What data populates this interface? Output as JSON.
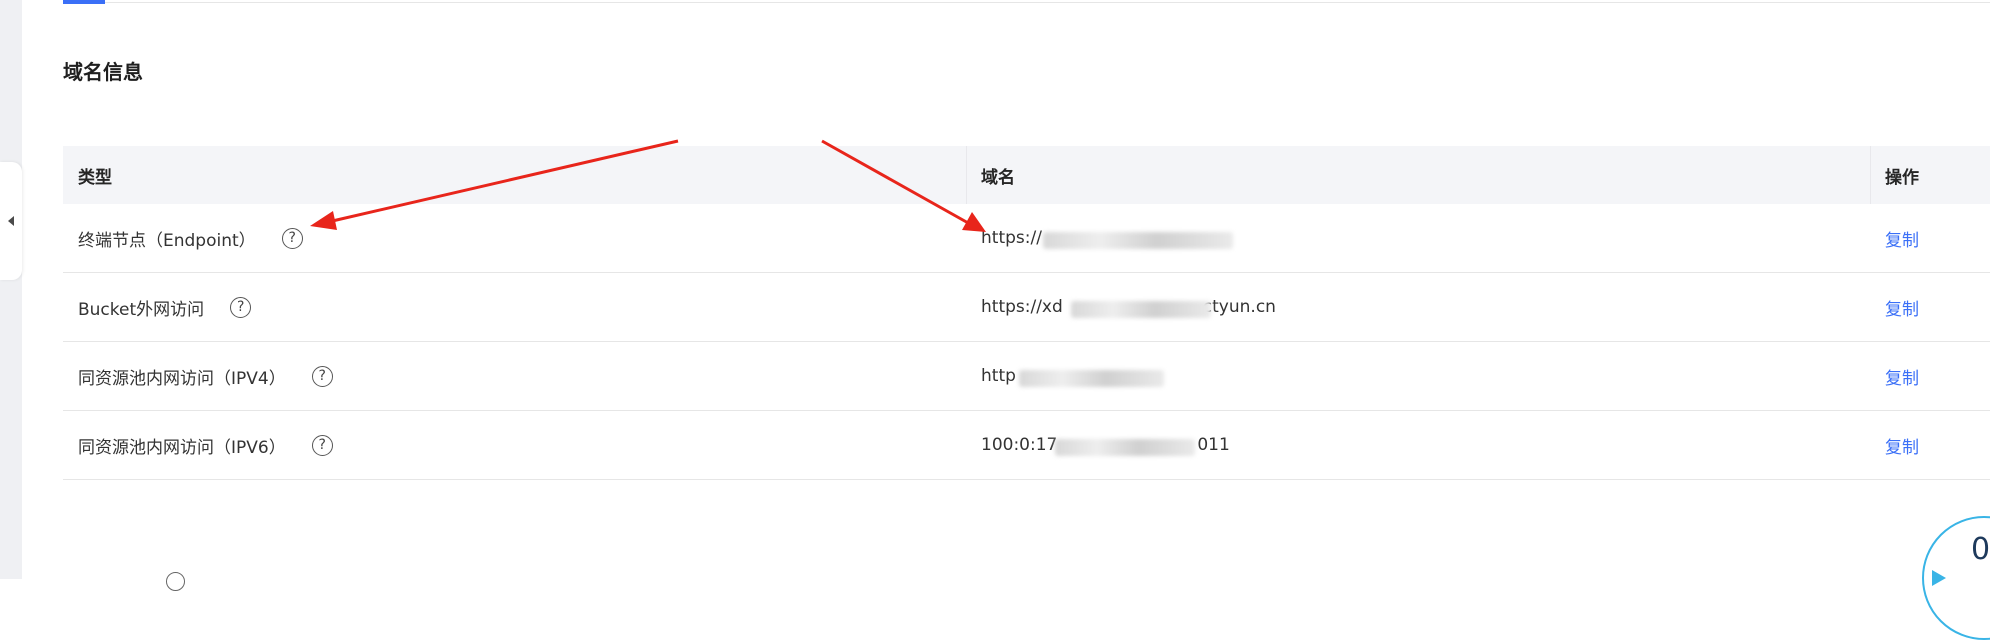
{
  "section": {
    "title": "域名信息"
  },
  "table": {
    "headers": {
      "type": "类型",
      "domain": "域名",
      "action": "操作"
    },
    "rows": [
      {
        "type": "终端节点（Endpoint）",
        "domain_visible": "https://",
        "domain_suffix": "",
        "action": "复制"
      },
      {
        "type": "Bucket外网访问",
        "domain_visible": "https://xd",
        "domain_suffix": "ctyun.cn",
        "action": "复制"
      },
      {
        "type": "同资源池内网访问（IPV4）",
        "domain_visible": "http",
        "domain_suffix": "",
        "action": "复制"
      },
      {
        "type": "同资源池内网访问（IPV6）",
        "domain_visible": "100:0:17",
        "domain_suffix": "011",
        "action": "复制"
      }
    ]
  },
  "help_icon_glyph": "?",
  "floating_badge": {
    "value": "0"
  },
  "colors": {
    "accent": "#3a6ff7",
    "arrow": "#e8251b",
    "badge_border": "#39b4e6"
  }
}
